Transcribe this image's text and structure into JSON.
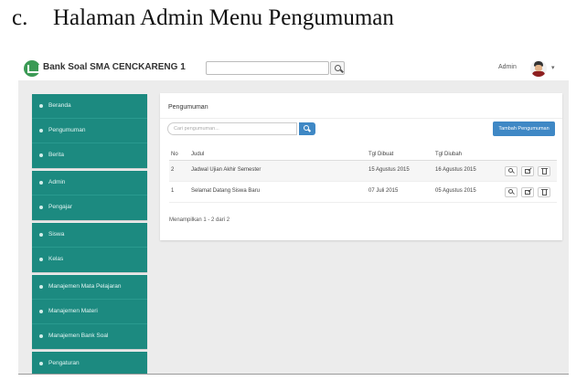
{
  "caption": {
    "letter": "c.",
    "text": "Halaman Admin Menu Pengumuman"
  },
  "navbar": {
    "brand": "Bank Soal SMA CENCKARENG 1",
    "search_placeholder": "",
    "user_name": "Admin"
  },
  "sidebar": {
    "groups": [
      {
        "items": [
          {
            "label": "Beranda"
          },
          {
            "label": "Pengumuman"
          },
          {
            "label": "Berita"
          }
        ]
      },
      {
        "items": [
          {
            "label": "Admin"
          },
          {
            "label": "Pengajar"
          }
        ]
      },
      {
        "items": [
          {
            "label": "Siswa"
          },
          {
            "label": "Kelas"
          }
        ]
      },
      {
        "items": [
          {
            "label": "Manajemen Mata Pelajaran"
          },
          {
            "label": "Manajemen Materi"
          },
          {
            "label": "Manajemen Bank Soal"
          }
        ]
      },
      {
        "items": [
          {
            "label": "Pengaturan"
          }
        ]
      }
    ]
  },
  "panel": {
    "title": "Pengumuman",
    "search_placeholder": "Cari pengumuman...",
    "add_button": "Tambah Pengumuman",
    "columns": {
      "no": "No",
      "judul": "Judul",
      "dibuat": "Tgl Dibuat",
      "diubah": "Tgl Diubah"
    },
    "rows": [
      {
        "no": "2",
        "judul": "Jadwal Ujian Akhir Semester",
        "dibuat": "15 Agustus 2015",
        "diubah": "16 Agustus 2015"
      },
      {
        "no": "1",
        "judul": "Selamat Datang Siswa Baru",
        "dibuat": "07 Juli 2015",
        "diubah": "05 Agustus 2015"
      }
    ],
    "footer": "Menampilkan 1 - 2 dari 2"
  },
  "colors": {
    "sidebar": "#1c8a80",
    "primary_button": "#3f88c5",
    "brand_logo": "#3b9a55"
  }
}
